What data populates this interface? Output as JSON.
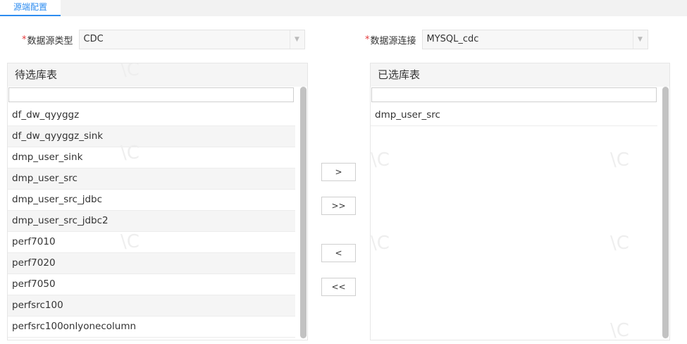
{
  "tabs": [
    {
      "label": "源端配置",
      "active": true
    }
  ],
  "source_type": {
    "required_mark": "*",
    "label": "数据源类型",
    "value": "CDC"
  },
  "source_conn": {
    "required_mark": "*",
    "label": "数据源连接",
    "value": "MYSQL_cdc"
  },
  "pending": {
    "title": "待选库表",
    "search_value": "",
    "items": [
      "df_dw_qyyggz",
      "df_dw_qyyggz_sink",
      "dmp_user_sink",
      "dmp_user_src",
      "dmp_user_src_jdbc",
      "dmp_user_src_jdbc2",
      "perf7010",
      "perf7020",
      "perf7050",
      "perfsrc100",
      "perfsrc100onlyonecolumn"
    ]
  },
  "selected": {
    "title": "已选库表",
    "search_value": "",
    "items": [
      "dmp_user_src"
    ]
  },
  "transfer_buttons": {
    "move_right": ">",
    "move_all_right": ">>",
    "move_left": "<",
    "move_all_left": "<<"
  },
  "colors": {
    "accent": "#2d8cf0",
    "required": "#e4393c"
  }
}
